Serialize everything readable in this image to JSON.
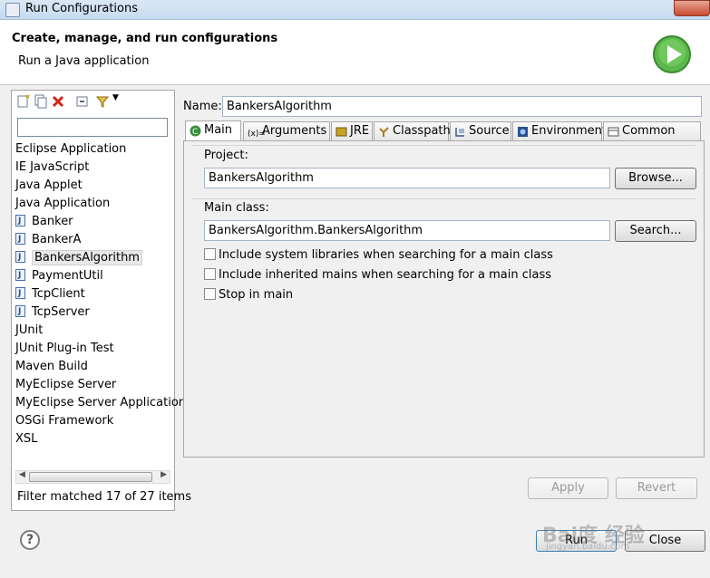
{
  "window": {
    "title": "Run Configurations"
  },
  "header": {
    "title": "Create, manage, and run configurations",
    "subtitle": "Run a Java application"
  },
  "left_panel": {
    "filter_value": "",
    "tree": [
      {
        "label": "Eclipse Application",
        "child": false
      },
      {
        "label": "IE JavaScript",
        "child": false
      },
      {
        "label": "Java Applet",
        "child": false
      },
      {
        "label": "Java Application",
        "child": false
      },
      {
        "label": "Banker",
        "child": true
      },
      {
        "label": "BankerA",
        "child": true
      },
      {
        "label": "BankersAlgorithm",
        "child": true,
        "selected": true
      },
      {
        "label": "PaymentUtil",
        "child": true
      },
      {
        "label": "TcpClient",
        "child": true
      },
      {
        "label": "TcpServer",
        "child": true
      },
      {
        "label": "JUnit",
        "child": false
      },
      {
        "label": "JUnit Plug-in Test",
        "child": false
      },
      {
        "label": "Maven Build",
        "child": false
      },
      {
        "label": "MyEclipse Server",
        "child": false
      },
      {
        "label": "MyEclipse Server Application",
        "child": false
      },
      {
        "label": "OSGi Framework",
        "child": false
      },
      {
        "label": "XSL",
        "child": false
      }
    ],
    "status": "Filter matched 17 of 27 items"
  },
  "config": {
    "name_label": "Name:",
    "name_value": "BankersAlgorithm",
    "tabs": [
      "Main",
      "Arguments",
      "JRE",
      "Classpath",
      "Source",
      "Environment",
      "Common"
    ],
    "project_label": "Project:",
    "project_value": "BankersAlgorithm",
    "browse_label": "Browse...",
    "mainclass_label": "Main class:",
    "mainclass_value": "BankersAlgorithm.BankersAlgorithm",
    "search_label": "Search...",
    "checkboxes": [
      "Include system libraries when searching for a main class",
      "Include inherited mains when searching for a main class",
      "Stop in main"
    ],
    "apply_label": "Apply",
    "revert_label": "Revert"
  },
  "footer": {
    "help": "?",
    "run_label": "Run",
    "close_label": "Close"
  },
  "watermark": {
    "main": "Bai度 经验",
    "sub": "jingyan.baidu.com"
  }
}
